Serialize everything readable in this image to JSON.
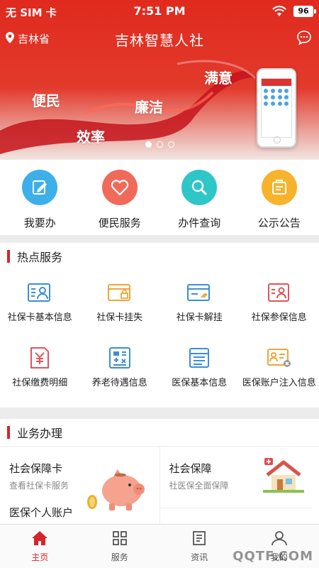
{
  "status": {
    "carrier": "无 SIM 卡",
    "time": "7:51 PM",
    "battery": "96"
  },
  "header": {
    "location": "吉林省",
    "title": "吉林智慧人社"
  },
  "banner": {
    "words": [
      "便民",
      "效率",
      "廉洁",
      "满意"
    ],
    "slides": 3,
    "active_slide": 1
  },
  "quick": [
    {
      "label": "我要办",
      "icon": "edit-icon",
      "color": "#3db0ea"
    },
    {
      "label": "便民服务",
      "icon": "heart-icon",
      "color": "#f06a5a"
    },
    {
      "label": "办件查询",
      "icon": "search-icon",
      "color": "#2fc6c8"
    },
    {
      "label": "公示公告",
      "icon": "notice-icon",
      "color": "#f7b32b"
    }
  ],
  "hot": {
    "title": "热点服务",
    "items": [
      {
        "label": "社保卡基本信息",
        "icon": "id-card-icon"
      },
      {
        "label": "社保卡挂失",
        "icon": "card-lock-icon"
      },
      {
        "label": "社保卡解挂",
        "icon": "card-unlock-icon"
      },
      {
        "label": "社保参保信息",
        "icon": "profile-card-icon"
      },
      {
        "label": "社保缴费明细",
        "icon": "yuan-doc-icon"
      },
      {
        "label": "养老待遇信息",
        "icon": "calculator-icon"
      },
      {
        "label": "医保基本信息",
        "icon": "list-doc-icon"
      },
      {
        "label": "医保账户注入信息",
        "icon": "account-card-icon"
      }
    ]
  },
  "business": {
    "title": "业务办理",
    "left": {
      "title": "社会保障卡",
      "subtitle": "查看社保卡服务",
      "second": "医保个人账户"
    },
    "right": {
      "title": "社会保障",
      "subtitle": "社医保全面保障"
    }
  },
  "tabs": [
    {
      "label": "主页",
      "icon": "home-icon",
      "active": true
    },
    {
      "label": "服务",
      "icon": "grid-icon",
      "active": false
    },
    {
      "label": "资讯",
      "icon": "news-icon",
      "active": false
    },
    {
      "label": "我的",
      "icon": "user-icon",
      "active": false
    }
  ],
  "watermark": "QQTF.COM"
}
